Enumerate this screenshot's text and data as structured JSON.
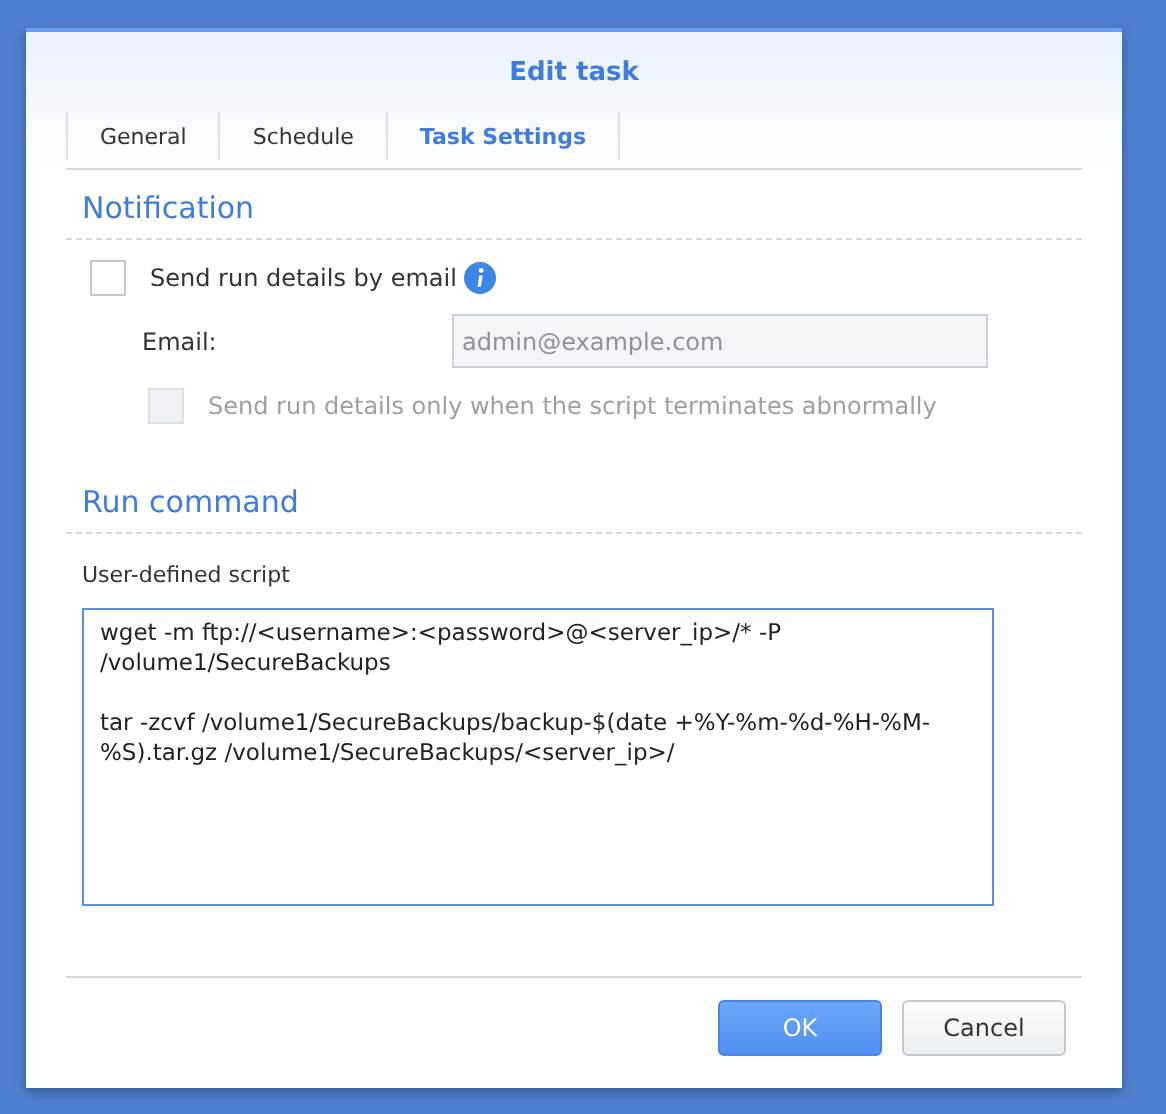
{
  "window": {
    "title": "Edit task"
  },
  "tabs": [
    {
      "label": "General",
      "selected": false
    },
    {
      "label": "Schedule",
      "selected": false
    },
    {
      "label": "Task Settings",
      "selected": true
    }
  ],
  "notification": {
    "heading": "Notification",
    "send_by_email": {
      "label": "Send run details by email",
      "checked": false
    },
    "email": {
      "label": "Email:",
      "placeholder": "admin@example.com",
      "disabled": true
    },
    "only_abnormal": {
      "label": "Send run details only when the script terminates abnormally",
      "checked": false,
      "disabled": true
    }
  },
  "run_command": {
    "heading": "Run command",
    "script_label": "User-defined script",
    "script": "wget -m ftp://<username>:<password>@<server_ip>/* -P /volume1/SecureBackups\n\ntar -zcvf /volume1/SecureBackups/backup-$(date +%Y-%m-%d-%H-%M-%S).tar.gz /volume1/SecureBackups/<server_ip>/"
  },
  "buttons": [
    {
      "label": "OK",
      "kind": "primary"
    },
    {
      "label": "Cancel",
      "kind": "secondary"
    }
  ]
}
